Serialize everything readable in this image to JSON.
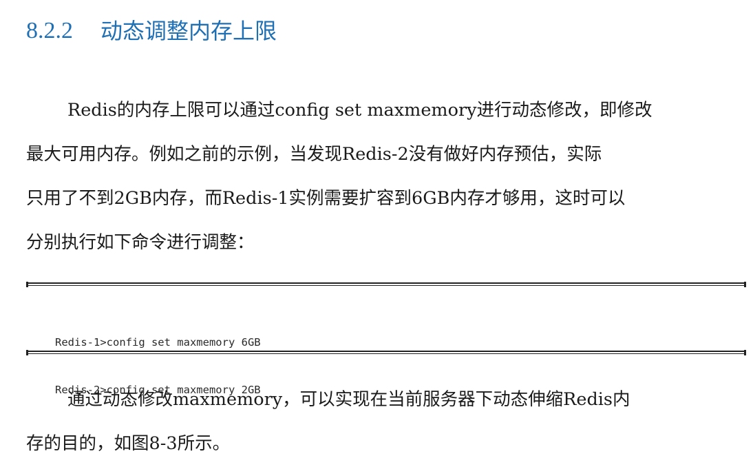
{
  "section": {
    "number": "8.2.2",
    "title": "动态调整内存上限"
  },
  "paragraph1": {
    "lines": [
      "Redis的内存上限可以通过config set maxmemory进行动态修改，即修改",
      "最大可用内存。例如之前的示例，当发现Redis-2没有做好内存预估，实际",
      "只用了不到2GB内存，而Redis-1实例需要扩容到6GB内存才够用，这时可以",
      "分别执行如下命令进行调整："
    ]
  },
  "code": {
    "lines": [
      "Redis-1>config set maxmemory 6GB",
      "Redis-2>config set maxmemory 2GB"
    ]
  },
  "paragraph2": {
    "lines": [
      "通过动态修改maxmemory，可以实现在当前服务器下动态伸缩Redis内",
      "存的目的，如图8-3所示。"
    ]
  }
}
